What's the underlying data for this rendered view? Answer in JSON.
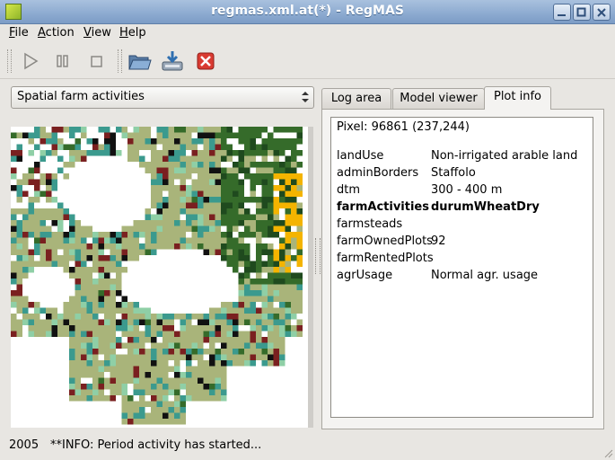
{
  "window": {
    "title": "regmas.xml.at(*) - RegMAS"
  },
  "menu": [
    {
      "label": "File",
      "accel": "F",
      "rest": "ile"
    },
    {
      "label": "Action",
      "accel": "A",
      "rest": "ction"
    },
    {
      "label": "View",
      "accel": "V",
      "rest": "iew"
    },
    {
      "label": "Help",
      "accel": "H",
      "rest": "elp"
    }
  ],
  "toolbar": {
    "icons": [
      "play-icon",
      "pause-icon",
      "stop-icon",
      "open-folder-icon",
      "save-icon",
      "close-icon"
    ]
  },
  "layer_select": {
    "selected": "Spatial farm activities"
  },
  "tabs": [
    {
      "label": "Log area",
      "active": false
    },
    {
      "label": "Model viewer",
      "active": false
    },
    {
      "label": "Plot info",
      "active": true
    }
  ],
  "plot_info": {
    "pixel": "Pixel: 96861 (237,244)",
    "rows": [
      {
        "key": "landUse",
        "value": "Non-irrigated arable land",
        "bold": false
      },
      {
        "key": "adminBorders",
        "value": "Staffolo",
        "bold": false
      },
      {
        "key": "dtm",
        "value": "300 - 400 m",
        "bold": false
      },
      {
        "key": "farmActivities",
        "value": "durumWheatDry",
        "bold": true
      },
      {
        "key": "farmsteads",
        "value": "",
        "bold": false
      },
      {
        "key": "farmOwnedPlots",
        "value": "92",
        "bold": false
      },
      {
        "key": "farmRentedPlots",
        "value": "",
        "bold": false
      },
      {
        "key": "agrUsage",
        "value": "Normal agr. usage",
        "bold": false
      }
    ]
  },
  "status": {
    "year": "2005",
    "message": "**INFO: Period activity has started..."
  },
  "colors": {
    "olive": "#a9b47a",
    "teal": "#3b9a8e",
    "darkred": "#7a2020",
    "darkgreen": "#356b2a",
    "forest": "#1f4a1e",
    "yellow": "#f4b400",
    "black": "#111111",
    "mint": "#8fcfa6"
  }
}
